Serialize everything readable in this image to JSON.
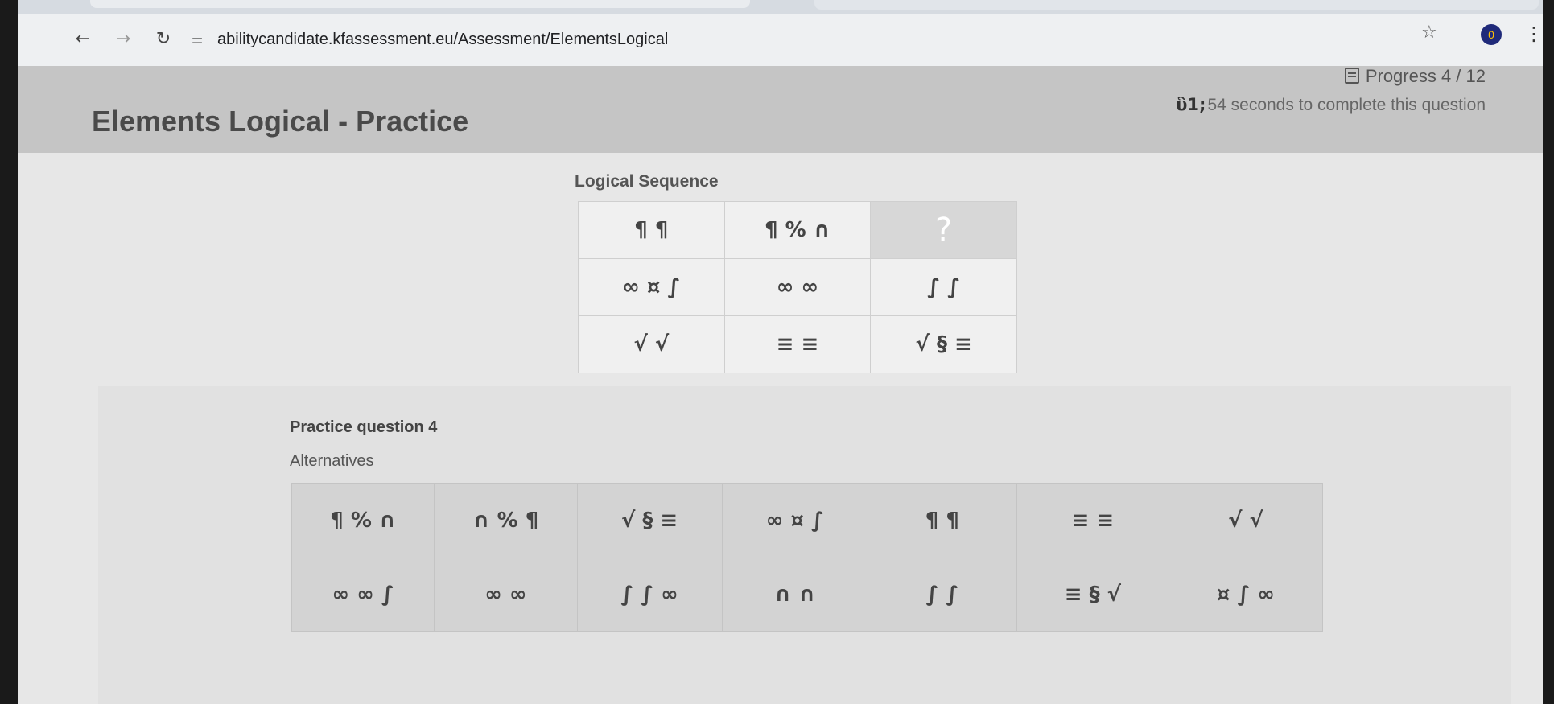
{
  "browser": {
    "url": "abilitycandidate.kfassessment.eu/Assessment/ElementsLogical",
    "profile_initial": "0"
  },
  "header": {
    "title": "Elements Logical - Practice",
    "progress": "Progress 4 / 12",
    "timer": "54 seconds to complete this question"
  },
  "sequence": {
    "label": "Logical Sequence",
    "rows": [
      [
        "¶ ¶",
        "¶ % ∩",
        "?"
      ],
      [
        "∞ ¤ ∫",
        "∞ ∞",
        "∫ ∫"
      ],
      [
        "√ √",
        "≡ ≡",
        "√ § ≡"
      ]
    ]
  },
  "practice": {
    "title": "Practice question 4",
    "alternatives_label": "Alternatives",
    "alternatives": [
      [
        "¶ % ∩",
        "∩ % ¶",
        "√ § ≡",
        "∞ ¤ ∫",
        "¶ ¶",
        "≡ ≡",
        "√ √"
      ],
      [
        "∞ ∞ ∫",
        "∞ ∞",
        "∫ ∫ ∞",
        "∩ ∩",
        "∫ ∫",
        "≡ § √",
        "¤ ∫ ∞"
      ]
    ]
  },
  "icons": {
    "back": "arrow-left-icon",
    "forward": "arrow-right-icon",
    "reload": "reload-icon",
    "site_info": "tune-icon",
    "bookmark": "star-icon",
    "menu": "kebab-icon",
    "progress": "document-icon",
    "timer": "stopwatch-icon"
  }
}
